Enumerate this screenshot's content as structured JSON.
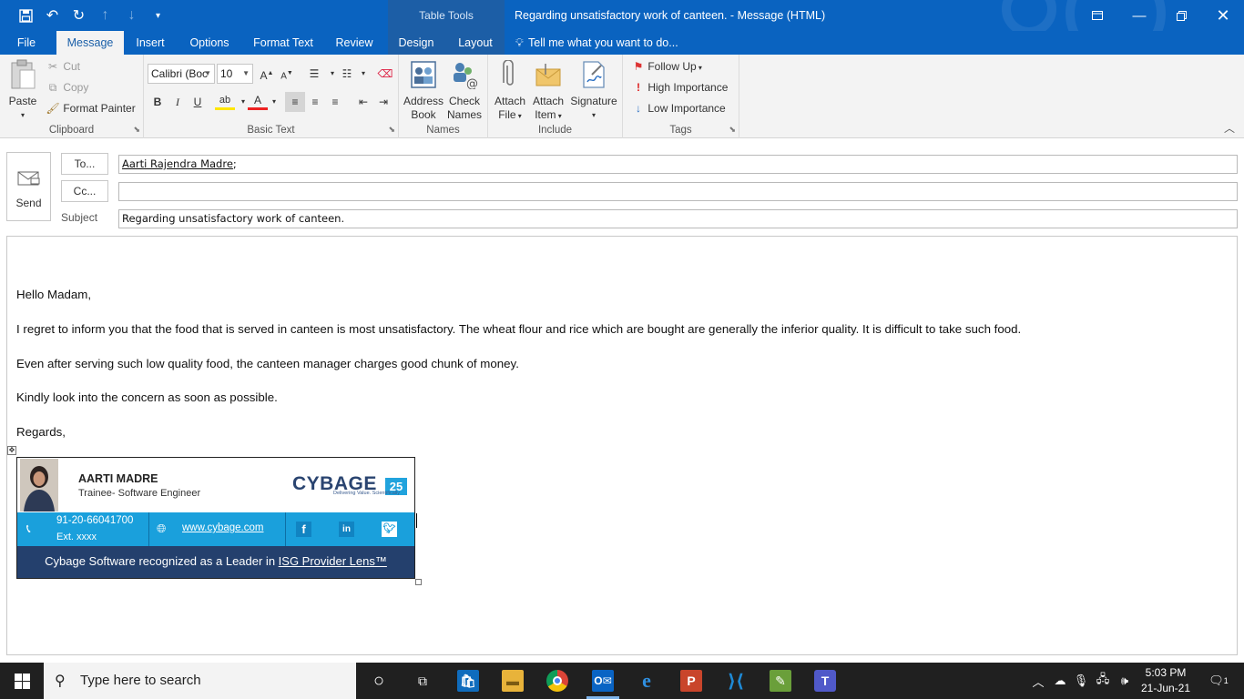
{
  "titlebar": {
    "context_tab": "Table Tools",
    "window_title": "Regarding unsatisfactory work of canteen. - Message (HTML)"
  },
  "ribbon_tabs": [
    "File",
    "Message",
    "Insert",
    "Options",
    "Format Text",
    "Review",
    "Design",
    "Layout"
  ],
  "tell_me": "Tell me what you want to do...",
  "clipboard": {
    "paste": "Paste",
    "cut": "Cut",
    "copy": "Copy",
    "format_painter": "Format Painter",
    "label": "Clipboard"
  },
  "basic_text": {
    "font": "Calibri (Boc",
    "size": "10",
    "label": "Basic Text"
  },
  "names": {
    "address_book": [
      "Address",
      "Book"
    ],
    "check_names": [
      "Check",
      "Names"
    ],
    "label": "Names"
  },
  "include": {
    "attach_file": [
      "Attach",
      "File"
    ],
    "attach_item": [
      "Attach",
      "Item"
    ],
    "signature": "Signature",
    "label": "Include"
  },
  "tags": {
    "follow_up": "Follow Up",
    "high_importance": "High Importance",
    "low_importance": "Low Importance",
    "label": "Tags"
  },
  "compose": {
    "send": "Send",
    "to_button": "To...",
    "cc_button": "Cc...",
    "subject_label": "Subject",
    "to_value": "Aarti Rajendra Madre",
    "to_sep": ";",
    "cc_value": "",
    "subject_value": "Regarding unsatisfactory work of canteen."
  },
  "body": {
    "greeting": "Hello Madam,",
    "p1": "I regret to inform you that the food that is served in canteen is most unsatisfactory. The wheat flour and rice which are bought are generally the inferior quality. It is difficult to take such food.",
    "p2": "Even after serving such low quality food, the canteen manager charges good chunk of money.",
    "p3": "Kindly look into the concern as soon as possible.",
    "closing": "Regards,"
  },
  "signature": {
    "name": "AARTI MADRE",
    "role": "Trainee- Software Engineer",
    "logo": "CYBAGE",
    "logo_badge": "25",
    "tagline": "Delivering Value. Scientifically",
    "phone": "91-20-66041700",
    "ext": "Ext. xxxx",
    "website": "www.cybage.com",
    "banner_text": "Cybage Software recognized as a Leader in ",
    "banner_link": "ISG Provider Lens™"
  },
  "taskbar": {
    "search_placeholder": "Type here to search",
    "time": "5:03 PM",
    "date": "21-Jun-21",
    "notifications": "1"
  },
  "colors": {
    "title_blue": "#0a63c0",
    "ribbon_bg": "#f3f3f3",
    "sig_blue": "#1aa0dc",
    "sig_navy": "#24406d"
  }
}
